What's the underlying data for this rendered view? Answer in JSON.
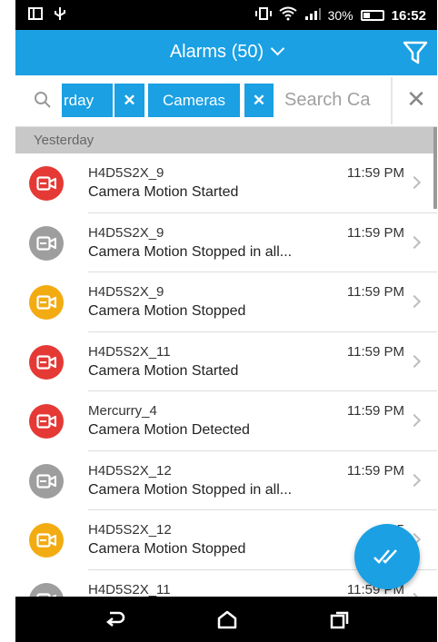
{
  "status_bar": {
    "battery_percent": "30%",
    "time": "16:52",
    "icons": [
      "screen-icon",
      "usb-icon",
      "vibrate-icon",
      "wifi-icon",
      "signal-icon",
      "battery-icon"
    ]
  },
  "app_bar": {
    "title": "Alarms (50)",
    "icons": [
      "chevron-down-icon",
      "filter-icon"
    ]
  },
  "filter_bar": {
    "chips": [
      {
        "label": "rday",
        "remove": "✕"
      },
      {
        "label": "Cameras",
        "remove": "✕"
      }
    ],
    "search_placeholder": "Search Ca",
    "clear": "✕"
  },
  "section_header": "Yesterday",
  "alarms": [
    {
      "name": "H4D5S2X_9",
      "event": "Camera Motion Started",
      "time": "11:59 PM",
      "color": "#e53935"
    },
    {
      "name": "H4D5S2X_9",
      "event": "Camera Motion Stopped in all...",
      "time": "11:59 PM",
      "color": "#9e9e9e"
    },
    {
      "name": "H4D5S2X_9",
      "event": "Camera Motion Stopped",
      "time": "11:59 PM",
      "color": "#f2ac12"
    },
    {
      "name": "H4D5S2X_11",
      "event": "Camera Motion Started",
      "time": "11:59 PM",
      "color": "#e53935"
    },
    {
      "name": "Mercurry_4",
      "event": "Camera Motion Detected",
      "time": "11:59 PM",
      "color": "#e53935"
    },
    {
      "name": "H4D5S2X_12",
      "event": "Camera Motion Stopped in all...",
      "time": "11:59 PM",
      "color": "#9e9e9e"
    },
    {
      "name": "H4D5S2X_12",
      "event": "Camera Motion Stopped",
      "time": "11:5",
      "color": "#f2ac12"
    },
    {
      "name": "H4D5S2X_11",
      "event": "",
      "time": "11:59 PM",
      "color": "#9e9e9e"
    }
  ],
  "nav_bar": {
    "icons": [
      "back-icon",
      "home-icon",
      "recents-icon"
    ]
  },
  "colors": {
    "accent": "#1aa0e3",
    "critical": "#e53935",
    "warning": "#f2ac12",
    "normal": "#9e9e9e"
  }
}
